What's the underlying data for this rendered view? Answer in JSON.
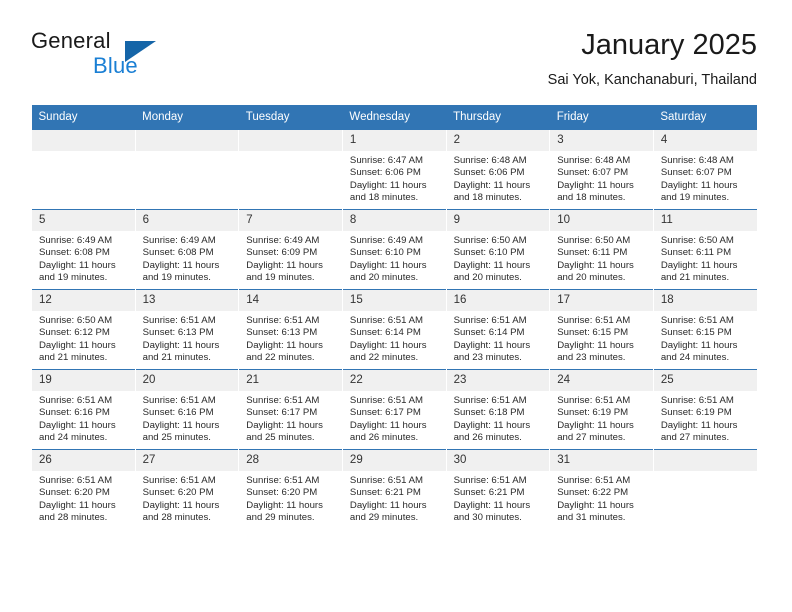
{
  "brand": {
    "word_top": "General",
    "word_bottom": "Blue",
    "triangle_color": "#1565a8",
    "blue_text_color": "#1a7fd4"
  },
  "header": {
    "title": "January 2025",
    "subtitle": "Sai Yok, Kanchanaburi, Thailand"
  },
  "theme": {
    "header_row_bg": "#3175b4",
    "daynum_bg": "#f0f0f0",
    "cell_bg": "#ffffff",
    "text_color": "#222222"
  },
  "calendar": {
    "weekday_headers": [
      "Sunday",
      "Monday",
      "Tuesday",
      "Wednesday",
      "Thursday",
      "Friday",
      "Saturday"
    ],
    "labels": {
      "sunrise_prefix": "Sunrise:",
      "sunset_prefix": "Sunset:",
      "daylight_prefix": "Daylight:"
    },
    "weeks": [
      [
        {
          "day": "",
          "empty": true
        },
        {
          "day": "",
          "empty": true
        },
        {
          "day": "",
          "empty": true
        },
        {
          "day": "1",
          "sunrise": "Sunrise: 6:47 AM",
          "sunset": "Sunset: 6:06 PM",
          "daylight_line1": "Daylight: 11 hours",
          "daylight_line2": "and 18 minutes."
        },
        {
          "day": "2",
          "sunrise": "Sunrise: 6:48 AM",
          "sunset": "Sunset: 6:06 PM",
          "daylight_line1": "Daylight: 11 hours",
          "daylight_line2": "and 18 minutes."
        },
        {
          "day": "3",
          "sunrise": "Sunrise: 6:48 AM",
          "sunset": "Sunset: 6:07 PM",
          "daylight_line1": "Daylight: 11 hours",
          "daylight_line2": "and 18 minutes."
        },
        {
          "day": "4",
          "sunrise": "Sunrise: 6:48 AM",
          "sunset": "Sunset: 6:07 PM",
          "daylight_line1": "Daylight: 11 hours",
          "daylight_line2": "and 19 minutes."
        }
      ],
      [
        {
          "day": "5",
          "sunrise": "Sunrise: 6:49 AM",
          "sunset": "Sunset: 6:08 PM",
          "daylight_line1": "Daylight: 11 hours",
          "daylight_line2": "and 19 minutes."
        },
        {
          "day": "6",
          "sunrise": "Sunrise: 6:49 AM",
          "sunset": "Sunset: 6:08 PM",
          "daylight_line1": "Daylight: 11 hours",
          "daylight_line2": "and 19 minutes."
        },
        {
          "day": "7",
          "sunrise": "Sunrise: 6:49 AM",
          "sunset": "Sunset: 6:09 PM",
          "daylight_line1": "Daylight: 11 hours",
          "daylight_line2": "and 19 minutes."
        },
        {
          "day": "8",
          "sunrise": "Sunrise: 6:49 AM",
          "sunset": "Sunset: 6:10 PM",
          "daylight_line1": "Daylight: 11 hours",
          "daylight_line2": "and 20 minutes."
        },
        {
          "day": "9",
          "sunrise": "Sunrise: 6:50 AM",
          "sunset": "Sunset: 6:10 PM",
          "daylight_line1": "Daylight: 11 hours",
          "daylight_line2": "and 20 minutes."
        },
        {
          "day": "10",
          "sunrise": "Sunrise: 6:50 AM",
          "sunset": "Sunset: 6:11 PM",
          "daylight_line1": "Daylight: 11 hours",
          "daylight_line2": "and 20 minutes."
        },
        {
          "day": "11",
          "sunrise": "Sunrise: 6:50 AM",
          "sunset": "Sunset: 6:11 PM",
          "daylight_line1": "Daylight: 11 hours",
          "daylight_line2": "and 21 minutes."
        }
      ],
      [
        {
          "day": "12",
          "sunrise": "Sunrise: 6:50 AM",
          "sunset": "Sunset: 6:12 PM",
          "daylight_line1": "Daylight: 11 hours",
          "daylight_line2": "and 21 minutes."
        },
        {
          "day": "13",
          "sunrise": "Sunrise: 6:51 AM",
          "sunset": "Sunset: 6:13 PM",
          "daylight_line1": "Daylight: 11 hours",
          "daylight_line2": "and 21 minutes."
        },
        {
          "day": "14",
          "sunrise": "Sunrise: 6:51 AM",
          "sunset": "Sunset: 6:13 PM",
          "daylight_line1": "Daylight: 11 hours",
          "daylight_line2": "and 22 minutes."
        },
        {
          "day": "15",
          "sunrise": "Sunrise: 6:51 AM",
          "sunset": "Sunset: 6:14 PM",
          "daylight_line1": "Daylight: 11 hours",
          "daylight_line2": "and 22 minutes."
        },
        {
          "day": "16",
          "sunrise": "Sunrise: 6:51 AM",
          "sunset": "Sunset: 6:14 PM",
          "daylight_line1": "Daylight: 11 hours",
          "daylight_line2": "and 23 minutes."
        },
        {
          "day": "17",
          "sunrise": "Sunrise: 6:51 AM",
          "sunset": "Sunset: 6:15 PM",
          "daylight_line1": "Daylight: 11 hours",
          "daylight_line2": "and 23 minutes."
        },
        {
          "day": "18",
          "sunrise": "Sunrise: 6:51 AM",
          "sunset": "Sunset: 6:15 PM",
          "daylight_line1": "Daylight: 11 hours",
          "daylight_line2": "and 24 minutes."
        }
      ],
      [
        {
          "day": "19",
          "sunrise": "Sunrise: 6:51 AM",
          "sunset": "Sunset: 6:16 PM",
          "daylight_line1": "Daylight: 11 hours",
          "daylight_line2": "and 24 minutes."
        },
        {
          "day": "20",
          "sunrise": "Sunrise: 6:51 AM",
          "sunset": "Sunset: 6:16 PM",
          "daylight_line1": "Daylight: 11 hours",
          "daylight_line2": "and 25 minutes."
        },
        {
          "day": "21",
          "sunrise": "Sunrise: 6:51 AM",
          "sunset": "Sunset: 6:17 PM",
          "daylight_line1": "Daylight: 11 hours",
          "daylight_line2": "and 25 minutes."
        },
        {
          "day": "22",
          "sunrise": "Sunrise: 6:51 AM",
          "sunset": "Sunset: 6:17 PM",
          "daylight_line1": "Daylight: 11 hours",
          "daylight_line2": "and 26 minutes."
        },
        {
          "day": "23",
          "sunrise": "Sunrise: 6:51 AM",
          "sunset": "Sunset: 6:18 PM",
          "daylight_line1": "Daylight: 11 hours",
          "daylight_line2": "and 26 minutes."
        },
        {
          "day": "24",
          "sunrise": "Sunrise: 6:51 AM",
          "sunset": "Sunset: 6:19 PM",
          "daylight_line1": "Daylight: 11 hours",
          "daylight_line2": "and 27 minutes."
        },
        {
          "day": "25",
          "sunrise": "Sunrise: 6:51 AM",
          "sunset": "Sunset: 6:19 PM",
          "daylight_line1": "Daylight: 11 hours",
          "daylight_line2": "and 27 minutes."
        }
      ],
      [
        {
          "day": "26",
          "sunrise": "Sunrise: 6:51 AM",
          "sunset": "Sunset: 6:20 PM",
          "daylight_line1": "Daylight: 11 hours",
          "daylight_line2": "and 28 minutes."
        },
        {
          "day": "27",
          "sunrise": "Sunrise: 6:51 AM",
          "sunset": "Sunset: 6:20 PM",
          "daylight_line1": "Daylight: 11 hours",
          "daylight_line2": "and 28 minutes."
        },
        {
          "day": "28",
          "sunrise": "Sunrise: 6:51 AM",
          "sunset": "Sunset: 6:20 PM",
          "daylight_line1": "Daylight: 11 hours",
          "daylight_line2": "and 29 minutes."
        },
        {
          "day": "29",
          "sunrise": "Sunrise: 6:51 AM",
          "sunset": "Sunset: 6:21 PM",
          "daylight_line1": "Daylight: 11 hours",
          "daylight_line2": "and 29 minutes."
        },
        {
          "day": "30",
          "sunrise": "Sunrise: 6:51 AM",
          "sunset": "Sunset: 6:21 PM",
          "daylight_line1": "Daylight: 11 hours",
          "daylight_line2": "and 30 minutes."
        },
        {
          "day": "31",
          "sunrise": "Sunrise: 6:51 AM",
          "sunset": "Sunset: 6:22 PM",
          "daylight_line1": "Daylight: 11 hours",
          "daylight_line2": "and 31 minutes."
        },
        {
          "day": "",
          "empty": true
        }
      ]
    ]
  }
}
